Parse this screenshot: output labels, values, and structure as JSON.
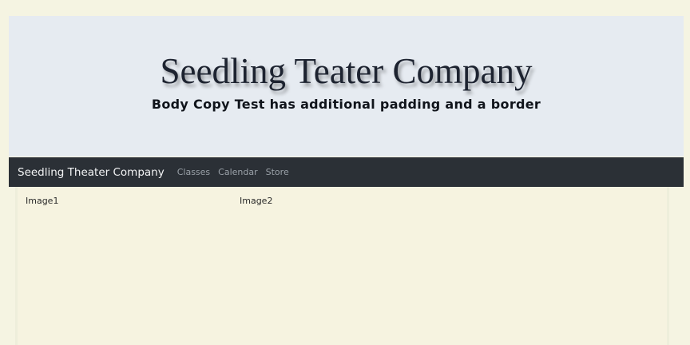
{
  "hero": {
    "title": "Seedling Teater Company",
    "subtitle": "Body Copy Test has additional padding and a border"
  },
  "navbar": {
    "brand": "Seedling Theater Company",
    "links": [
      "Classes",
      "Calendar",
      "Store"
    ]
  },
  "content": {
    "images": [
      "Image1",
      "Image2"
    ]
  },
  "colors": {
    "page_background": "#f5f4e2",
    "hero_background": "#e6ebf1",
    "navbar_background": "#2b3036"
  }
}
